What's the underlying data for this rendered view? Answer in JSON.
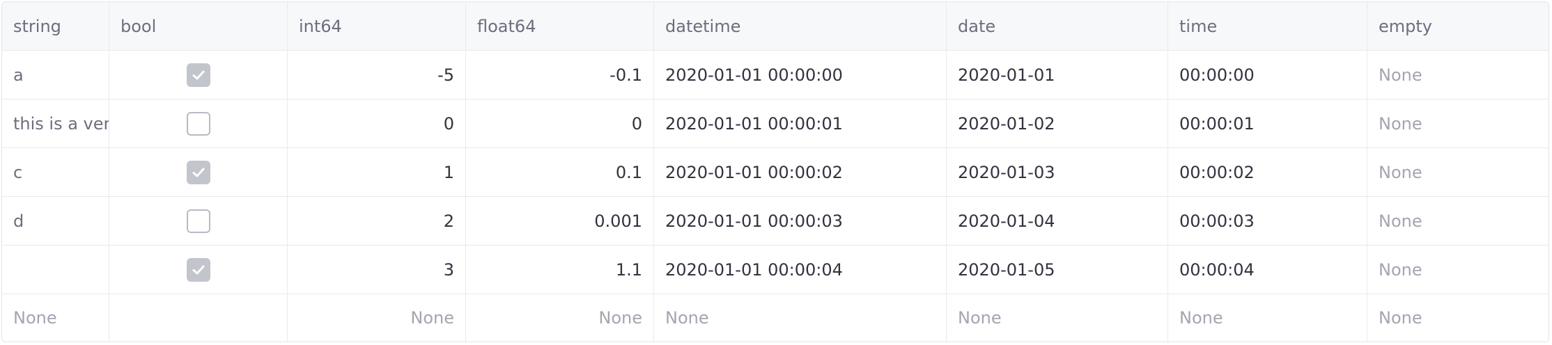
{
  "columns": [
    "string",
    "bool",
    "int64",
    "float64",
    "datetime",
    "date",
    "time",
    "empty"
  ],
  "null_text": "None",
  "rows": [
    {
      "string": "a",
      "bool": true,
      "int64": "-5",
      "float64": "-0.1",
      "datetime": "2020-01-01 00:00:00",
      "date": "2020-01-01",
      "time": "00:00:00",
      "empty": "None"
    },
    {
      "string": "this is a very",
      "bool": false,
      "int64": "0",
      "float64": "0",
      "datetime": "2020-01-01 00:00:01",
      "date": "2020-01-02",
      "time": "00:00:01",
      "empty": "None"
    },
    {
      "string": "c",
      "bool": true,
      "int64": "1",
      "float64": "0.1",
      "datetime": "2020-01-01 00:00:02",
      "date": "2020-01-03",
      "time": "00:00:02",
      "empty": "None"
    },
    {
      "string": "d",
      "bool": false,
      "int64": "2",
      "float64": "0.001",
      "datetime": "2020-01-01 00:00:03",
      "date": "2020-01-04",
      "time": "00:00:03",
      "empty": "None"
    },
    {
      "string": "",
      "bool": true,
      "int64": "3",
      "float64": "1.1",
      "datetime": "2020-01-01 00:00:04",
      "date": "2020-01-05",
      "time": "00:00:04",
      "empty": "None"
    },
    {
      "string": "None",
      "bool": null,
      "int64": "None",
      "float64": "None",
      "datetime": "None",
      "date": "None",
      "time": "None",
      "empty": "None"
    }
  ]
}
